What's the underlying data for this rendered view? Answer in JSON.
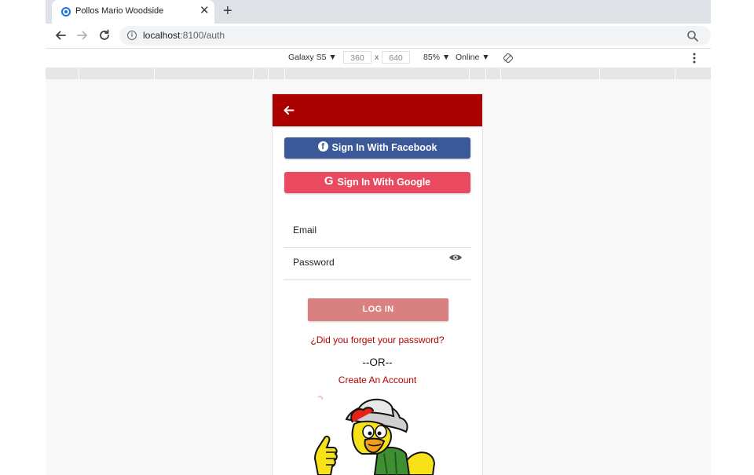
{
  "browser": {
    "tab_title": "Pollos Mario Woodside",
    "tab_close": "✕",
    "new_tab": "+",
    "url_host": "localhost",
    "url_path": ":8100/auth"
  },
  "device_toolbar": {
    "device": "Galaxy S5 ▼",
    "width": "360",
    "separator": "x",
    "height": "640",
    "zoom": "85% ▼",
    "network": "Online ▼"
  },
  "app": {
    "header_color": "#ab0000",
    "facebook_button": "Sign In With Facebook",
    "facebook_icon_glyph": "f",
    "google_button": "Sign In With Google",
    "google_icon_glyph": "G",
    "email_label": "Email",
    "password_label": "Password",
    "login_button": "LOG IN",
    "forgot_password": "¿Did you forget your password?",
    "or_separator": "--OR--",
    "create_account": "Create An Account",
    "mascot": "chicken-mascot-illustration"
  },
  "icons": {
    "back": "arrow-left-icon",
    "forward": "arrow-right-icon",
    "reload": "reload-icon",
    "info": "info-icon",
    "zoom": "magnifier-icon",
    "rotate": "rotate-icon",
    "more": "kebab-menu-icon",
    "eye": "eye-icon"
  },
  "colors": {
    "facebook": "#3b5998",
    "google": "#ea4a60",
    "login": "#d98080",
    "link": "#b00000"
  }
}
